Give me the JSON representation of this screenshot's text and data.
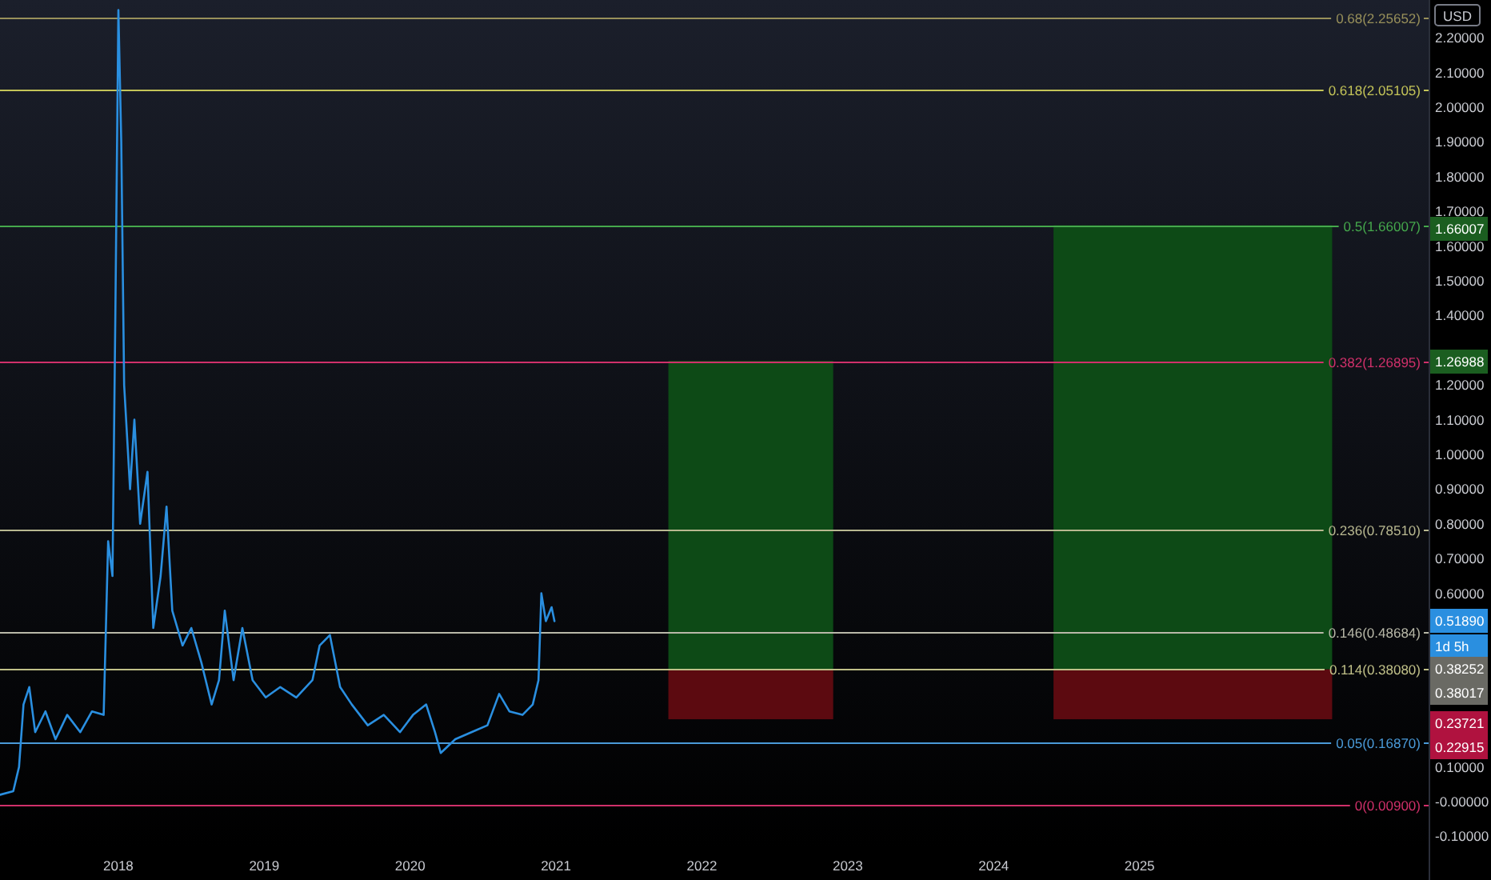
{
  "chart": {
    "chart_data": {
      "type": "line",
      "xlim": [
        2017.189,
        2026.981
      ],
      "ylim": [
        -0.1336,
        2.309
      ],
      "xticks": [
        {
          "value": 2018,
          "label": "2018"
        },
        {
          "value": 2019,
          "label": "2019"
        },
        {
          "value": 2020,
          "label": "2020"
        },
        {
          "value": 2021,
          "label": "2021"
        },
        {
          "value": 2022,
          "label": "2022"
        },
        {
          "value": 2023,
          "label": "2023"
        },
        {
          "value": 2024,
          "label": "2024"
        },
        {
          "value": 2025,
          "label": "2025"
        }
      ],
      "yticks": [
        {
          "value": 2.2,
          "label": "2.20000"
        },
        {
          "value": 2.1,
          "label": "2.10000"
        },
        {
          "value": 2.0,
          "label": "2.00000"
        },
        {
          "value": 1.9,
          "label": "1.90000"
        },
        {
          "value": 1.8,
          "label": "1.80000"
        },
        {
          "value": 1.7,
          "label": "1.70000"
        },
        {
          "value": 1.6,
          "label": "1.60000"
        },
        {
          "value": 1.5,
          "label": "1.50000"
        },
        {
          "value": 1.4,
          "label": "1.40000"
        },
        {
          "value": 1.2,
          "label": "1.20000"
        },
        {
          "value": 1.1,
          "label": "1.10000"
        },
        {
          "value": 1.0,
          "label": "1.00000"
        },
        {
          "value": 0.9,
          "label": "0.90000"
        },
        {
          "value": 0.8,
          "label": "0.80000"
        },
        {
          "value": 0.7,
          "label": "0.70000"
        },
        {
          "value": 0.6,
          "label": "0.60000"
        },
        {
          "value": 0.1,
          "label": "0.10000"
        },
        {
          "value": 0.0,
          "label": "-0.00000"
        },
        {
          "value": -0.1,
          "label": "-0.10000"
        }
      ],
      "x": [
        2017.19,
        2017.28,
        2017.32,
        2017.35,
        2017.39,
        2017.43,
        2017.5,
        2017.57,
        2017.65,
        2017.74,
        2017.82,
        2017.9,
        2017.93,
        2017.96,
        2017.98,
        2018.0,
        2018.02,
        2018.04,
        2018.08,
        2018.11,
        2018.15,
        2018.2,
        2018.24,
        2018.29,
        2018.33,
        2018.37,
        2018.44,
        2018.5,
        2018.57,
        2018.64,
        2018.69,
        2018.73,
        2018.79,
        2018.85,
        2018.92,
        2019.01,
        2019.11,
        2019.22,
        2019.33,
        2019.38,
        2019.45,
        2019.52,
        2019.6,
        2019.71,
        2019.82,
        2019.93,
        2020.02,
        2020.11,
        2020.17,
        2020.21,
        2020.31,
        2020.42,
        2020.53,
        2020.61,
        2020.68,
        2020.77,
        2020.84,
        2020.88,
        2020.9,
        2020.93,
        2020.97,
        2020.99
      ],
      "series": [
        {
          "color": "#2a8fe0",
          "values": [
            0.02,
            0.03,
            0.1,
            0.28,
            0.33,
            0.2,
            0.26,
            0.18,
            0.25,
            0.2,
            0.26,
            0.25,
            0.75,
            0.65,
            1.4,
            2.28,
            1.9,
            1.2,
            0.9,
            1.1,
            0.8,
            0.95,
            0.5,
            0.65,
            0.85,
            0.55,
            0.45,
            0.5,
            0.4,
            0.28,
            0.35,
            0.55,
            0.35,
            0.5,
            0.35,
            0.3,
            0.33,
            0.3,
            0.35,
            0.45,
            0.48,
            0.33,
            0.28,
            0.22,
            0.25,
            0.2,
            0.25,
            0.28,
            0.2,
            0.14,
            0.18,
            0.2,
            0.22,
            0.31,
            0.26,
            0.25,
            0.28,
            0.35,
            0.6,
            0.52,
            0.56,
            0.52
          ]
        }
      ],
      "ref_lines": [
        {
          "axis": "y",
          "value": 2.25652,
          "label": "0.68(2.25652)",
          "color": "#98905a"
        },
        {
          "axis": "y",
          "value": 2.05105,
          "label": "0.618(2.05105)",
          "color": "#c4c458"
        },
        {
          "axis": "y",
          "value": 1.66007,
          "label": "0.5(1.66007)",
          "color": "#45a84c"
        },
        {
          "axis": "y",
          "value": 1.26895,
          "label": "0.382(1.26895)",
          "color": "#d0306a"
        },
        {
          "axis": "y",
          "value": 0.7851,
          "label": "0.236(0.78510)",
          "color": "#b8b890"
        },
        {
          "axis": "y",
          "value": 0.48684,
          "label": "0.146(0.48684)",
          "color": "#b8b8a8"
        },
        {
          "axis": "y",
          "value": 0.3808,
          "label": "0.114(0.38080)",
          "color": "#c0c088"
        },
        {
          "axis": "y",
          "value": 0.1687,
          "label": "0.05(0.16870)",
          "color": "#4a9ad8"
        },
        {
          "axis": "y",
          "value": -0.009,
          "label": "0(0.00900)",
          "color": "#d0306a"
        }
      ]
    },
    "position_tools": [
      {
        "kind": "long"
      },
      {
        "kind": "long"
      }
    ],
    "price_badges": [
      {
        "label": "1.66007",
        "color": "#1b5e20"
      },
      {
        "label": "1.26988",
        "color": "#1b5e20"
      },
      {
        "label": "0.51890",
        "color": "#2a8fe0"
      },
      {
        "label": "1d 5h",
        "color": "#2a8fe0"
      },
      {
        "label": "0.38252",
        "color": "#6a6a64"
      },
      {
        "label": "0.38017",
        "color": "#6a6a64"
      },
      {
        "label": "0.23721",
        "color": "#b0123f"
      },
      {
        "label": "0.22915",
        "color": "#b0123f"
      }
    ],
    "currency": "USD"
  }
}
